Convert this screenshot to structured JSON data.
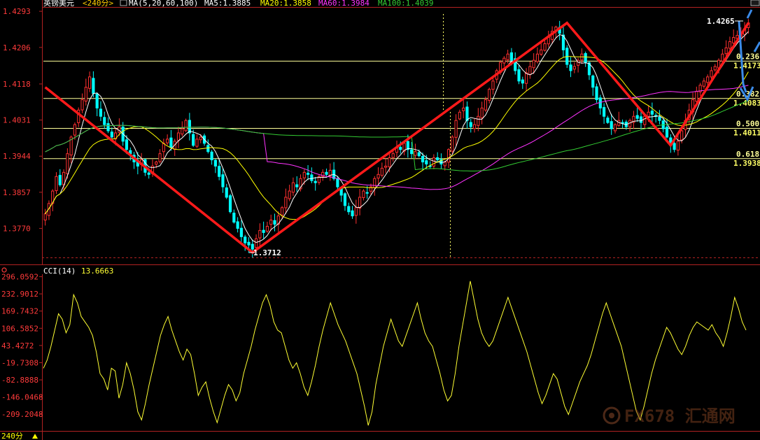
{
  "header": {
    "symbol": "英镑美元",
    "period": "<240分>",
    "ma_label": "MA(5,20,60,100)",
    "ma5": "MA5:1.3885",
    "ma20": "MA20:1.3858",
    "ma60": "MA60:1.3984",
    "ma100": "MA100:1.4039"
  },
  "lower_header": {
    "cci_label": "CCI(14)",
    "cci_value": "13.6663"
  },
  "footer": {
    "period_label": "240分"
  },
  "watermark": "FX678 汇通网",
  "fib_labels": [
    "0.236",
    "1.4173",
    "0.382",
    "1.4083",
    "0.500",
    "1.4011",
    "0.618",
    "1.3938"
  ],
  "colors": {
    "up": "#ff3030",
    "down": "#00ffff",
    "ma5": "#ffffff",
    "ma20": "#ffff00",
    "ma60": "#ff33ff",
    "ma100": "#33cc33",
    "trend": "#ff1a1a",
    "arrow": "#3b8be8",
    "fib": "#ffff99",
    "cci": "#ffff33",
    "axis_text": "#ff3b3b"
  },
  "chart_data": [
    {
      "type": "candlestick",
      "y_ticks": [
        "1.4293",
        "1.4206",
        "1.4118",
        "1.4031",
        "1.3944",
        "1.3857",
        "1.3770"
      ],
      "ylim": [
        1.37,
        1.43
      ],
      "annotations": [
        "1.4265",
        "1.3712"
      ],
      "fib_levels": [
        {
          "ratio": "0.236",
          "price": 1.4173
        },
        {
          "ratio": "0.382",
          "price": 1.4083
        },
        {
          "ratio": "0.500",
          "price": 1.4011
        },
        {
          "ratio": "0.618",
          "price": 1.3938
        }
      ],
      "trend_points": [
        {
          "bar": 0,
          "price": 1.411
        },
        {
          "bar": 56,
          "price": 1.3712
        },
        {
          "bar": 141,
          "price": 1.4265
        },
        {
          "bar": 169,
          "price": 1.397
        },
        {
          "bar": 190,
          "price": 1.4265
        }
      ],
      "close": [
        1.3805,
        1.383,
        1.386,
        1.3895,
        1.3875,
        1.3905,
        1.395,
        1.399,
        1.402,
        1.4055,
        1.408,
        1.411,
        1.4135,
        1.4095,
        1.406,
        1.404,
        1.402,
        1.4005,
        1.399,
        1.4,
        1.4015,
        1.398,
        1.396,
        1.395,
        1.393,
        1.392,
        1.3935,
        1.3905,
        1.39,
        1.392,
        1.393,
        1.395,
        1.3975,
        1.3985,
        1.3965,
        1.398,
        1.4,
        1.401,
        1.403,
        1.4,
        1.397,
        1.3985,
        1.399,
        1.3975,
        1.3955,
        1.3935,
        1.392,
        1.3895,
        1.387,
        1.3845,
        1.381,
        1.3785,
        1.377,
        1.375,
        1.3735,
        1.373,
        1.372,
        1.3745,
        1.3765,
        1.376,
        1.3775,
        1.379,
        1.378,
        1.38,
        1.382,
        1.3845,
        1.386,
        1.388,
        1.387,
        1.389,
        1.3905,
        1.39,
        1.3885,
        1.388,
        1.3895,
        1.3905,
        1.39,
        1.391,
        1.389,
        1.387,
        1.385,
        1.3825,
        1.381,
        1.38,
        1.382,
        1.3845,
        1.386,
        1.3855,
        1.387,
        1.389,
        1.39,
        1.3915,
        1.392,
        1.394,
        1.395,
        1.3965,
        1.396,
        1.3975,
        1.396,
        1.395,
        1.3955,
        1.3945,
        1.393,
        1.3925,
        1.392,
        1.394,
        1.3935,
        1.3925,
        1.393,
        1.396,
        1.399,
        1.403,
        1.405,
        1.406,
        1.403,
        1.4015,
        1.402,
        1.404,
        1.406,
        1.408,
        1.4105,
        1.4125,
        1.415,
        1.417,
        1.418,
        1.419,
        1.4175,
        1.415,
        1.4125,
        1.412,
        1.4145,
        1.416,
        1.4175,
        1.419,
        1.42,
        1.4215,
        1.423,
        1.4245,
        1.4255,
        1.424,
        1.42,
        1.4165,
        1.415,
        1.416,
        1.4175,
        1.419,
        1.417,
        1.414,
        1.411,
        1.408,
        1.406,
        1.404,
        1.4025,
        1.401,
        1.402,
        1.403,
        1.4025,
        1.4015,
        1.403,
        1.404,
        1.4035,
        1.4025,
        1.404,
        1.405,
        1.4045,
        1.404,
        1.403,
        1.401,
        1.399,
        1.397,
        1.396,
        1.398,
        1.4005,
        1.403,
        1.4055,
        1.408,
        1.41,
        1.4115,
        1.4125,
        1.4135,
        1.415,
        1.416,
        1.4175,
        1.419,
        1.4205,
        1.422,
        1.423,
        1.4235,
        1.424,
        1.425,
        1.4265
      ],
      "ma_periods": [
        5,
        20,
        60,
        100
      ]
    },
    {
      "type": "line",
      "name": "CCI(14)",
      "y_ticks": [
        "296.0592",
        "232.9012",
        "169.7432",
        "106.5852",
        "43.4272",
        "-19.7308",
        "-82.8888",
        "-146.0468",
        "-209.2048"
      ],
      "ylim": [
        -260,
        300
      ],
      "values": [
        -40,
        -10,
        40,
        100,
        160,
        140,
        90,
        120,
        230,
        200,
        150,
        130,
        110,
        80,
        20,
        -60,
        -80,
        -120,
        -40,
        -50,
        -150,
        -100,
        -20,
        -60,
        -120,
        -200,
        -230,
        -170,
        -100,
        -40,
        20,
        80,
        120,
        150,
        100,
        60,
        20,
        -10,
        30,
        10,
        -60,
        -140,
        -110,
        -90,
        -150,
        -200,
        -240,
        -190,
        -140,
        -100,
        -120,
        -160,
        -130,
        -60,
        -10,
        40,
        100,
        150,
        200,
        230,
        190,
        130,
        100,
        90,
        40,
        -10,
        -40,
        -20,
        -60,
        -110,
        -140,
        -90,
        -30,
        40,
        100,
        150,
        200,
        160,
        120,
        90,
        60,
        20,
        -20,
        -60,
        -120,
        -180,
        -250,
        -200,
        -100,
        -30,
        40,
        90,
        140,
        100,
        60,
        40,
        80,
        120,
        160,
        200,
        140,
        90,
        60,
        40,
        -10,
        -60,
        -120,
        -160,
        -140,
        -60,
        40,
        120,
        200,
        280,
        210,
        140,
        90,
        60,
        40,
        60,
        100,
        140,
        180,
        220,
        180,
        140,
        100,
        60,
        20,
        -30,
        -80,
        -130,
        -170,
        -140,
        -100,
        -60,
        -80,
        -130,
        -180,
        -210,
        -170,
        -130,
        -90,
        -60,
        -30,
        10,
        60,
        110,
        160,
        200,
        160,
        120,
        80,
        40,
        -20,
        -80,
        -140,
        -200,
        -230,
        -180,
        -120,
        -60,
        -10,
        30,
        70,
        110,
        90,
        60,
        30,
        10,
        40,
        80,
        110,
        130,
        120,
        110,
        100,
        120,
        90,
        70,
        40,
        90,
        150,
        220,
        180,
        130,
        100
      ]
    }
  ]
}
